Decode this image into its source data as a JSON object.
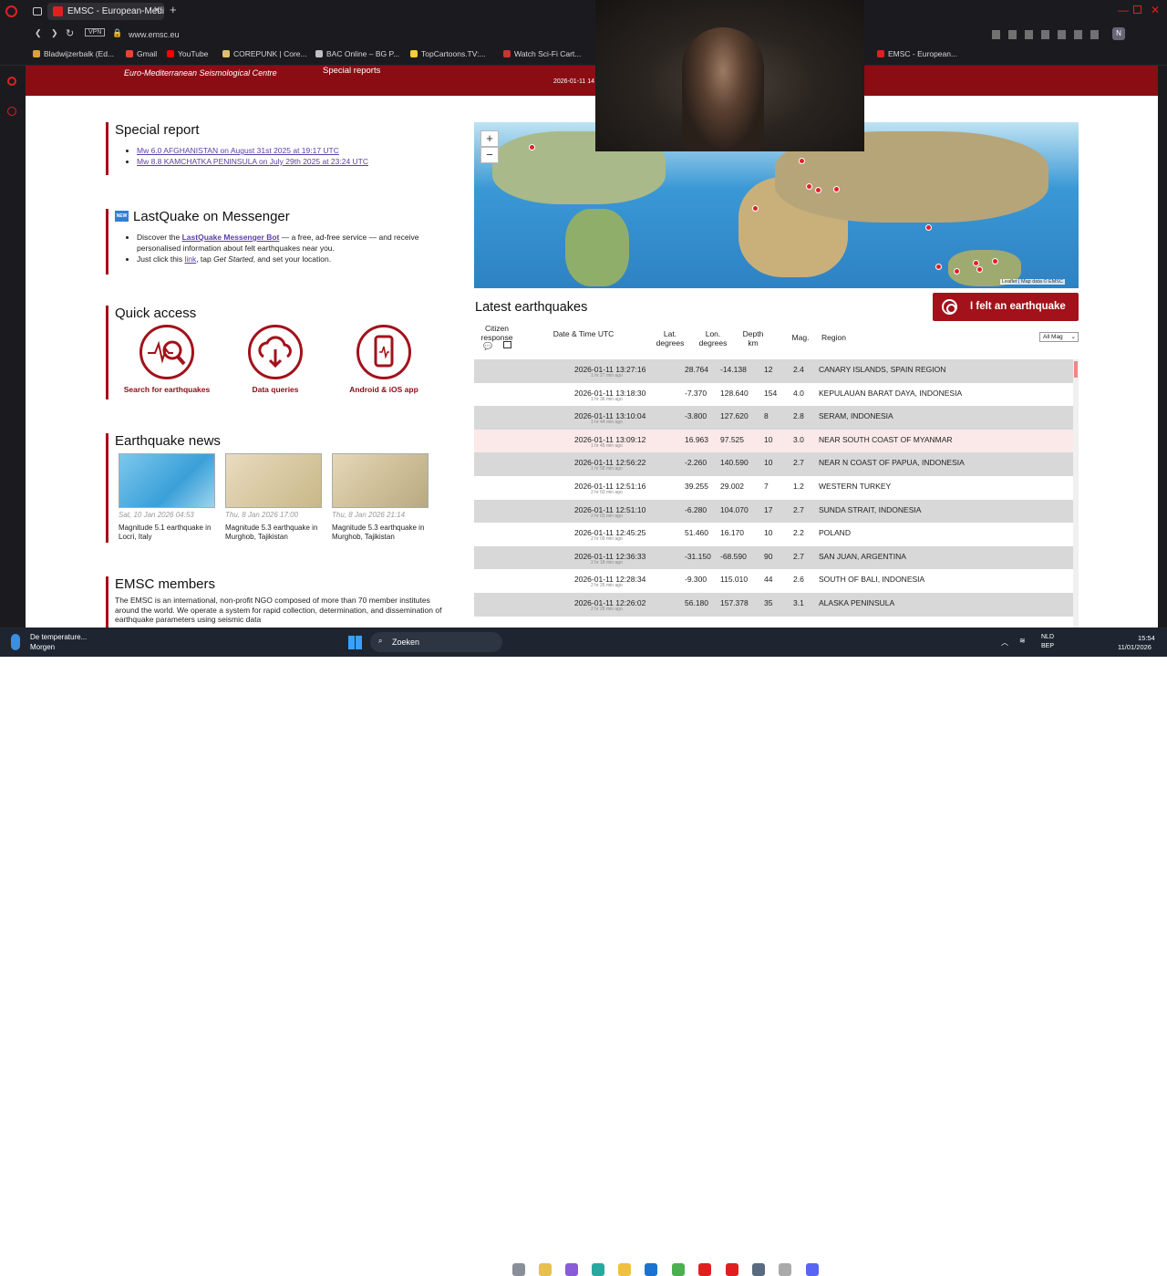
{
  "browser": {
    "tab_title": "EMSC - European-Medite...",
    "address": "www.emsc.eu",
    "vpn_label": "VPN",
    "bookmarks": [
      {
        "label": "Bladwijzerbalk (Ed...",
        "color": "#d9a23a"
      },
      {
        "label": "Gmail",
        "color": "#ea4335"
      },
      {
        "label": "YouTube",
        "color": "#ff0000"
      },
      {
        "label": "COREPUNK | Core...",
        "color": "#e0c06a"
      },
      {
        "label": "BAC Online – BG P...",
        "color": "#c0c0c0"
      },
      {
        "label": "TopCartoons.TV:...",
        "color": "#ffcc33"
      },
      {
        "label": "Watch Sci-Fi Cart...",
        "color": "#cc3333"
      },
      {
        "label": "EMSC - European...",
        "color": "#e02020"
      }
    ]
  },
  "site_header": {
    "org_line": "Euro-Mediterranean Seismological Centre",
    "nav_special": "Special reports",
    "datetime": "2026-01-11 14"
  },
  "special_report": {
    "title": "Special report",
    "links": [
      "Mw 6.0 AFGHANISTAN on August 31st 2025 at 19:17 UTC",
      "Mw 8.8 KAMCHATKA PENINSULA on July 29th 2025 at 23:24 UTC"
    ]
  },
  "lastquake": {
    "badge": "NEW",
    "title": "LastQuake on Messenger",
    "line1_pre": "Discover the ",
    "line1_link": "LastQuake Messenger Bot",
    "line1_post": " — a free, ad-free service — and receive personalised information about felt earthquakes near you.",
    "line2_pre": "Just click this ",
    "line2_link": "link",
    "line2_mid": ", tap ",
    "line2_em": "Get Started",
    "line2_post": ", and set your location."
  },
  "quick_access": {
    "title": "Quick access",
    "items": [
      {
        "label": "Search for earthquakes",
        "icon": "search-seismogram-icon"
      },
      {
        "label": "Data queries",
        "icon": "cloud-download-icon"
      },
      {
        "label": "Android & iOS app",
        "icon": "smartphone-icon"
      }
    ]
  },
  "news": {
    "title": "Earthquake news",
    "items": [
      {
        "date": "Sat, 10 Jan 2026 04:53",
        "caption": "Magnitude 5.1 earthquake in Locri, Italy"
      },
      {
        "date": "Thu, 8 Jan 2026 17:00",
        "caption": "Magnitude 5.3 earthquake in Murghob, Tajikistan"
      },
      {
        "date": "Thu, 8 Jan 2026 21:14",
        "caption": "Magnitude 5.3 earthquake in Murghob, Tajikistan"
      }
    ]
  },
  "members": {
    "title": "EMSC members",
    "text": "The EMSC is an international, non-profit NGO composed of more than 70 member institutes around the world. We operate a system for rapid collection, determination, and dissemination of earthquake parameters using seismic data"
  },
  "map": {
    "zoom_in": "+",
    "zoom_out": "−",
    "attribution": "Leaflet | Map data © EMSC"
  },
  "latest": {
    "title": "Latest earthquakes",
    "felt_button": "I felt an earthquake",
    "headers": {
      "citizen": "Citizen response",
      "date": "Date & Time UTC",
      "lat": "Lat. degrees",
      "lon": "Lon. degrees",
      "depth": "Depth km",
      "mag": "Mag.",
      "region": "Region"
    },
    "filter": "All Mag",
    "rows": [
      {
        "dt": "2026-01-11 13:27:16",
        "ago": "1 hr 27 min ago",
        "lat": "28.764",
        "lon": "-14.138",
        "depth": "12",
        "mag": "2.4",
        "region": "CANARY ISLANDS, SPAIN REGION",
        "bg": "#d8d8d8"
      },
      {
        "dt": "2026-01-11 13:18:30",
        "ago": "1 hr 36 min ago",
        "lat": "-7.370",
        "lon": "128.640",
        "depth": "154",
        "mag": "4.0",
        "region": "KEPULAUAN BARAT DAYA, INDONESIA",
        "bg": "#ffffff"
      },
      {
        "dt": "2026-01-11 13:10:04",
        "ago": "1 hr 44 min ago",
        "lat": "-3.800",
        "lon": "127.620",
        "depth": "8",
        "mag": "2.8",
        "region": "SERAM, INDONESIA",
        "bg": "#d8d8d8"
      },
      {
        "dt": "2026-01-11 13:09:12",
        "ago": "1 hr 45 min ago",
        "lat": "16.963",
        "lon": "97.525",
        "depth": "10",
        "mag": "3.0",
        "region": "NEAR SOUTH COAST OF MYANMAR",
        "bg": "#fbe9e9"
      },
      {
        "dt": "2026-01-11 12:56:22",
        "ago": "1 hr 58 min ago",
        "lat": "-2.260",
        "lon": "140.590",
        "depth": "10",
        "mag": "2.7",
        "region": "NEAR N COAST OF PAPUA, INDONESIA",
        "bg": "#d8d8d8"
      },
      {
        "dt": "2026-01-11 12:51:16",
        "ago": "2 hr 03 min ago",
        "lat": "39.255",
        "lon": "29.002",
        "depth": "7",
        "mag": "1.2",
        "region": "WESTERN TURKEY",
        "bg": "#ffffff"
      },
      {
        "dt": "2026-01-11 12:51:10",
        "ago": "2 hr 03 min ago",
        "lat": "-6.280",
        "lon": "104.070",
        "depth": "17",
        "mag": "2.7",
        "region": "SUNDA STRAIT, INDONESIA",
        "bg": "#d8d8d8"
      },
      {
        "dt": "2026-01-11 12:45:25",
        "ago": "2 hr 09 min ago",
        "lat": "51.460",
        "lon": "16.170",
        "depth": "10",
        "mag": "2.2",
        "region": "POLAND",
        "bg": "#ffffff"
      },
      {
        "dt": "2026-01-11 12:36:33",
        "ago": "2 hr 18 min ago",
        "lat": "-31.150",
        "lon": "-68.590",
        "depth": "90",
        "mag": "2.7",
        "region": "SAN JUAN, ARGENTINA",
        "bg": "#d8d8d8"
      },
      {
        "dt": "2026-01-11 12:28:34",
        "ago": "2 hr 26 min ago",
        "lat": "-9.300",
        "lon": "115.010",
        "depth": "44",
        "mag": "2.6",
        "region": "SOUTH OF BALI, INDONESIA",
        "bg": "#ffffff"
      },
      {
        "dt": "2026-01-11 12:26:02",
        "ago": "2 hr 28 min ago",
        "lat": "56.180",
        "lon": "157.378",
        "depth": "35",
        "mag": "3.1",
        "region": "ALASKA PENINSULA",
        "bg": "#d8d8d8"
      }
    ]
  },
  "taskbar": {
    "weather_title": "De temperature...",
    "weather_sub": "Morgen",
    "search": "Zoeken",
    "lang1": "NLD",
    "lang2": "BEP",
    "time": "15:54",
    "date": "11/01/2026"
  },
  "colors": {
    "brand": "#a3111a",
    "header": "#8b0d14"
  }
}
